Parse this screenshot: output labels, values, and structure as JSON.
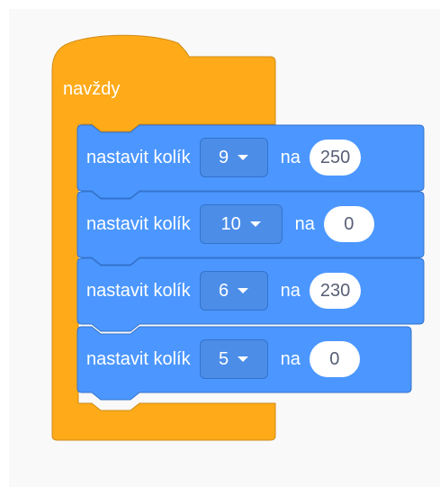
{
  "forever": {
    "label": "navždy"
  },
  "blocks": [
    {
      "label": "nastavit kolík",
      "pin": "9",
      "to_label": "na",
      "value": "250"
    },
    {
      "label": "nastavit kolík",
      "pin": "10",
      "to_label": "na",
      "value": "0"
    },
    {
      "label": "nastavit kolík",
      "pin": "6",
      "to_label": "na",
      "value": "230"
    },
    {
      "label": "nastavit kolík",
      "pin": "5",
      "to_label": "na",
      "value": "0"
    }
  ],
  "colors": {
    "control_orange": "#ffab19",
    "control_border": "#cf8b17",
    "pin_blue": "#4c97ff",
    "pin_border": "#3373cc",
    "canvas_bg": "#f9f9f9"
  },
  "icons": {
    "dropdown": "caret-down-icon"
  }
}
